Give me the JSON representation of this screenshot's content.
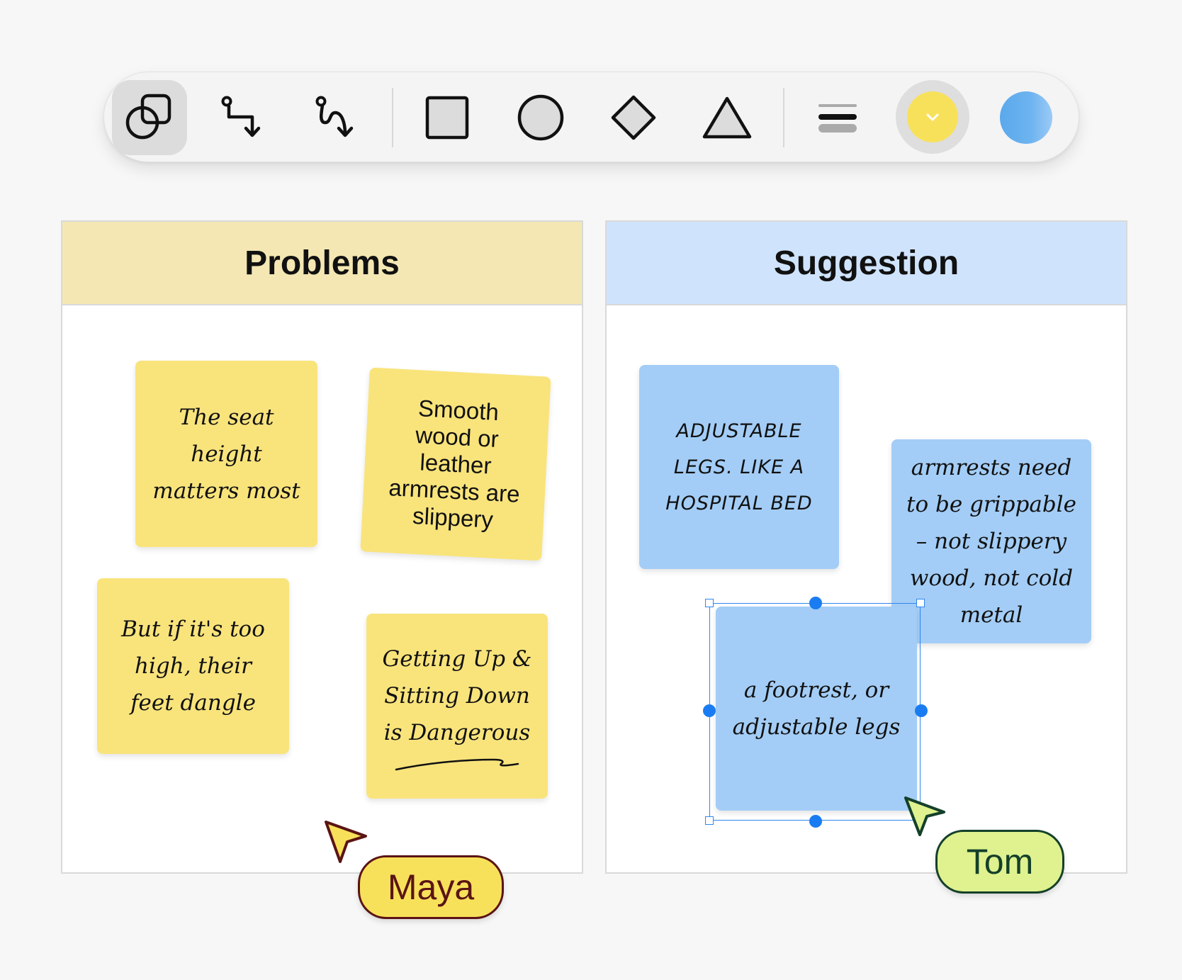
{
  "toolbar": {
    "tools": [
      {
        "name": "shapes-tool",
        "active": true
      },
      {
        "name": "elbow-connector-tool",
        "active": false
      },
      {
        "name": "curved-connector-tool",
        "active": false
      },
      {
        "name": "rectangle-tool",
        "active": false
      },
      {
        "name": "ellipse-tool",
        "active": false
      },
      {
        "name": "diamond-tool",
        "active": false
      },
      {
        "name": "triangle-tool",
        "active": false
      },
      {
        "name": "stroke-weight-tool",
        "active": false
      }
    ],
    "colors": {
      "selected": "#f8e15a",
      "alternate": "#5aa8ec"
    }
  },
  "columns": {
    "problems": {
      "title": "Problems",
      "header_color": "#f4e7b3"
    },
    "suggestion": {
      "title": "Suggestion",
      "header_color": "#cfe4fc"
    }
  },
  "notes": {
    "problems": [
      "The seat\nheight\nmatters most",
      "Smooth\nwood or\nleather\narmrests are\nslippery",
      "But if it's too\nhigh, their\nfeet dangle",
      "Getting Up &\nSitting Down\nis Dangerous"
    ],
    "suggestion": [
      "ADJUSTABLE\nLEGS. LIKE A\nHOSPITAL BED",
      "armrests need\nto be grippable\n– not slippery\nwood, not cold\nmetal",
      "a footrest, or\nadjustable legs"
    ]
  },
  "collaborators": [
    {
      "name": "Maya",
      "color": "#f8e15a",
      "outline": "#5a1414"
    },
    {
      "name": "Tom",
      "color": "#dff28f",
      "outline": "#14402a"
    }
  ]
}
